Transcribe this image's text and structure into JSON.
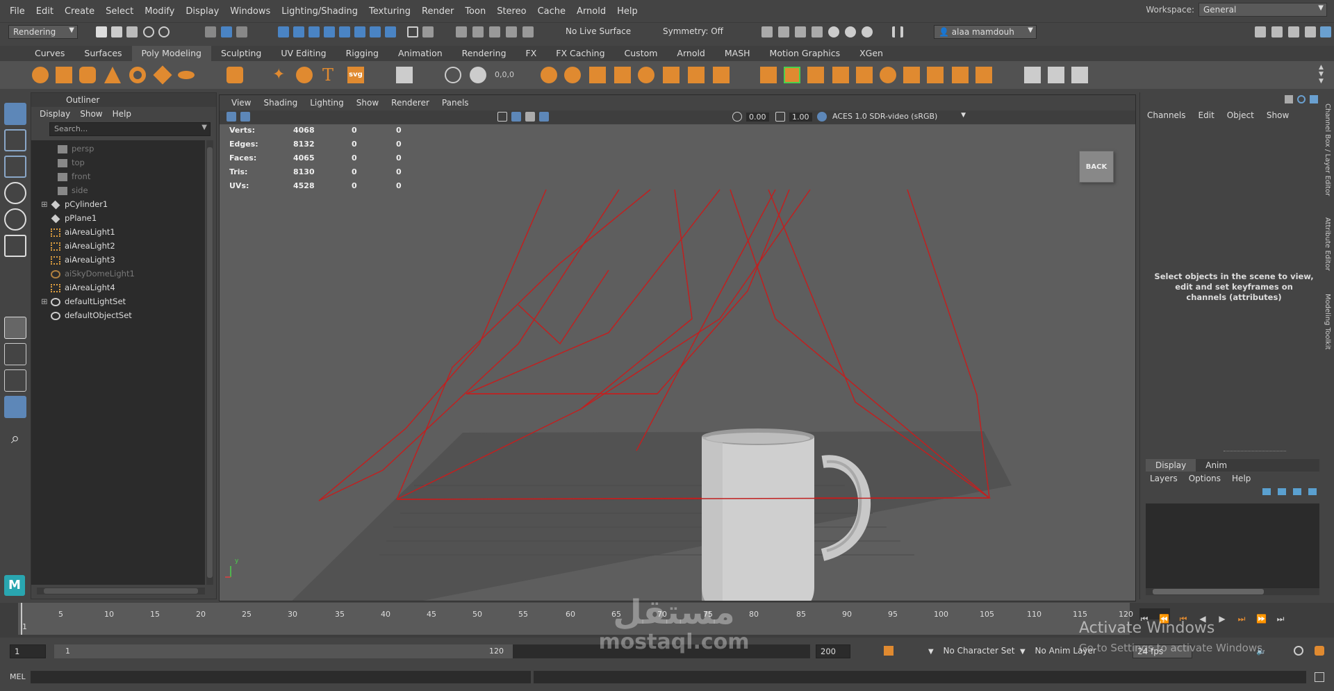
{
  "menu": [
    "File",
    "Edit",
    "Create",
    "Select",
    "Modify",
    "Display",
    "Windows",
    "Lighting/Shading",
    "Texturing",
    "Render",
    "Toon",
    "Stereo",
    "Cache",
    "Arnold",
    "Help"
  ],
  "workspace": {
    "label": "Workspace:",
    "value": "General"
  },
  "status": {
    "mode": "Rendering",
    "live_surface": "No Live Surface",
    "symmetry": "Symmetry: Off",
    "user": "alaa mamdouh"
  },
  "shelf_tabs": [
    "Curves",
    "Surfaces",
    "Poly Modeling",
    "Sculpting",
    "UV Editing",
    "Rigging",
    "Animation",
    "Rendering",
    "FX",
    "FX Caching",
    "Custom",
    "Arnold",
    "MASH",
    "Motion Graphics",
    "XGen"
  ],
  "shelf_active": "Poly Modeling",
  "outliner": {
    "title": "Outliner",
    "menu": [
      "Display",
      "Show",
      "Help"
    ],
    "search_placeholder": "Search...",
    "items": [
      {
        "label": "persp",
        "type": "camera",
        "dim": true
      },
      {
        "label": "top",
        "type": "camera",
        "dim": true
      },
      {
        "label": "front",
        "type": "camera",
        "dim": true
      },
      {
        "label": "side",
        "type": "camera",
        "dim": true
      },
      {
        "label": "pCylinder1",
        "type": "mesh",
        "dim": false,
        "expand": true
      },
      {
        "label": "pPlane1",
        "type": "mesh",
        "dim": false
      },
      {
        "label": "aiAreaLight1",
        "type": "light",
        "dim": false
      },
      {
        "label": "aiAreaLight2",
        "type": "light",
        "dim": false
      },
      {
        "label": "aiAreaLight3",
        "type": "light",
        "dim": false
      },
      {
        "label": "aiSkyDomeLight1",
        "type": "dome",
        "dim": true
      },
      {
        "label": "aiAreaLight4",
        "type": "light",
        "dim": false
      },
      {
        "label": "defaultLightSet",
        "type": "set",
        "dim": false,
        "expand": true
      },
      {
        "label": "defaultObjectSet",
        "type": "set",
        "dim": false
      }
    ]
  },
  "viewport": {
    "menu": [
      "View",
      "Shading",
      "Lighting",
      "Show",
      "Renderer",
      "Panels"
    ],
    "gamma": "0.00",
    "exposure": "1.00",
    "colorspace": "ACES 1.0 SDR-video (sRGB)",
    "hud": [
      {
        "label": "Verts:",
        "v1": "4068",
        "v2": "0",
        "v3": "0"
      },
      {
        "label": "Edges:",
        "v1": "8132",
        "v2": "0",
        "v3": "0"
      },
      {
        "label": "Faces:",
        "v1": "4065",
        "v2": "0",
        "v3": "0"
      },
      {
        "label": "Tris:",
        "v1": "8130",
        "v2": "0",
        "v3": "0"
      },
      {
        "label": "UVs:",
        "v1": "4528",
        "v2": "0",
        "v3": "0"
      }
    ],
    "viewcube": "BACK",
    "axis_y": "y"
  },
  "channel_box": {
    "menu": [
      "Channels",
      "Edit",
      "Object",
      "Show"
    ],
    "message": "Select objects in the scene to view, edit and set keyframes on channels (attributes)"
  },
  "layers": {
    "tabs": [
      "Display",
      "Anim"
    ],
    "active": "Display",
    "menu": [
      "Layers",
      "Options",
      "Help"
    ]
  },
  "side_tabs": [
    "Channel Box / Layer Editor",
    "Attribute Editor",
    "Modeling Toolkit"
  ],
  "timeline": {
    "ticks": [
      "1",
      "5",
      "10",
      "15",
      "20",
      "25",
      "30",
      "35",
      "40",
      "45",
      "50",
      "55",
      "60",
      "65",
      "70",
      "75",
      "80",
      "85",
      "90",
      "95",
      "100",
      "105",
      "110",
      "115",
      "120"
    ],
    "current": "1"
  },
  "range": {
    "start": "1",
    "inner_start": "1",
    "inner_end": "120",
    "end": "200",
    "character_set": "No Character Set",
    "anim_layer": "No Anim Layer",
    "fps": "24 fps"
  },
  "cmd": {
    "label": "MEL"
  },
  "watermark": {
    "arabic": "مستقل",
    "latin": "mostaql.com"
  },
  "activate": {
    "title": "Activate Windows",
    "sub": "Go to Settings to activate Windows."
  }
}
